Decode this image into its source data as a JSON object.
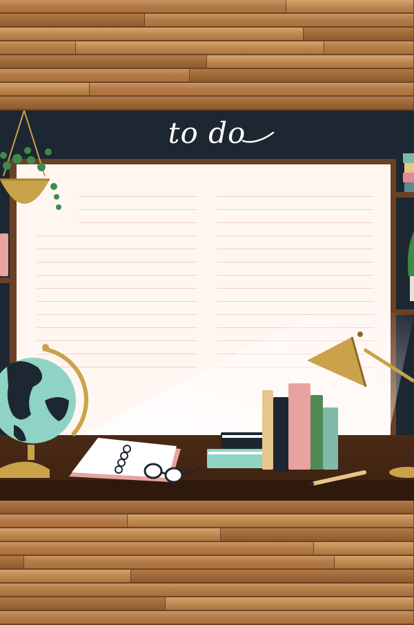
{
  "pad": {
    "title": "to do",
    "colors": {
      "chalkboard": "#1d2731",
      "paper": "#fff6f2",
      "ruled_line": "#f2cfc2",
      "frame": "#6a4124",
      "desk": "#4a2a16",
      "wood": "#b8804d"
    },
    "illustrations": [
      "hanging-plant-icon",
      "globe-icon",
      "notebook-icon",
      "glasses-icon",
      "books-icon",
      "desk-lamp-icon",
      "pencil-icon"
    ]
  }
}
